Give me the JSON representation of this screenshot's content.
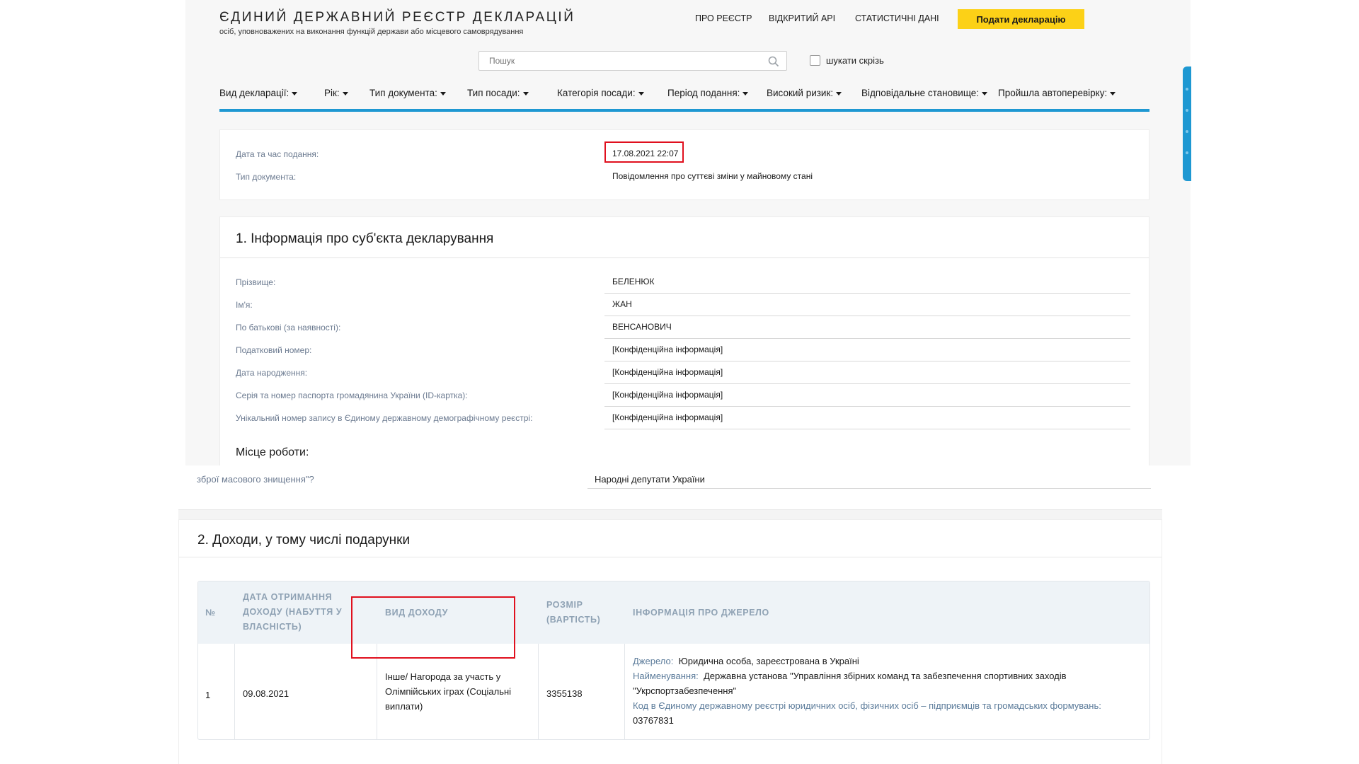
{
  "header": {
    "logo_title": "ЄДИНИЙ ДЕРЖАВНИЙ РЕЄСТР ДЕКЛАРАЦІЙ",
    "logo_subtitle": "осіб, уповноважених на виконання функцій держави або місцевого самоврядування",
    "nav": {
      "about": "ПРО РЕЄСТР",
      "api": "ВІДКРИТИЙ API",
      "stats": "СТАТИСТИЧНІ ДАНІ"
    },
    "submit_button": "Подати декларацію"
  },
  "search": {
    "placeholder": "Пошук",
    "search_everywhere_label": "шукати скрізь"
  },
  "filters": [
    "Вид декларації:",
    "Рік:",
    "Тип документа:",
    "Тип посади:",
    "Категорія посади:",
    "Період подання:",
    "Високий ризик:",
    "Відповідальне становище:",
    "Пройшла автоперевірку:"
  ],
  "meta": {
    "submitted_label": "Дата та час подання:",
    "submitted_value": "17.08.2021 22:07",
    "doc_type_label": "Тип документа:",
    "doc_type_value": "Повідомлення про суттєві зміни у майновому стані"
  },
  "subject": {
    "title": "1. Інформація про суб'єкта декларування",
    "rows": [
      {
        "label": "Прізвище:",
        "value": "БЕЛЕНЮК"
      },
      {
        "label": "Ім'я:",
        "value": "ЖАН"
      },
      {
        "label": "По батькові (за наявності):",
        "value": "ВЕНСАНОВИЧ"
      },
      {
        "label": "Податковий номер:",
        "value": "[Конфіденційна інформація]"
      },
      {
        "label": "Дата народження:",
        "value": "[Конфіденційна інформація]"
      },
      {
        "label": "Серія та номер паспорта громадянина України (ID-картка):",
        "value": "[Конфіденційна інформація]"
      },
      {
        "label": "Унікальний номер запису в Єдиному державному демографічному реєстрі:",
        "value": "[Конфіденційна інформація]"
      }
    ],
    "workplace_title": "Місце роботи:"
  },
  "fragment": {
    "left_text": "зброї масового знищення\"?",
    "right_text": "Народні депутати України"
  },
  "income": {
    "title": "2. Доходи, у тому числі подарунки",
    "headers": {
      "num": "№",
      "date": "ДАТА ОТРИМАННЯ ДОХОДУ (НАБУТТЯ У ВЛАСНІСТЬ)",
      "type": "ВИД ДОХОДУ",
      "amount": "РОЗМІР (ВАРТІСТЬ)",
      "source": "ІНФОРМАЦІЯ ПРО ДЖЕРЕЛО"
    },
    "row": {
      "num": "1",
      "date": "09.08.2021",
      "type": "Інше/ Нагорода за участь у Олімпійських іграх (Соціальні виплати)",
      "amount": "3355138",
      "source_label": "Джерело:",
      "source_value": "Юридична особа, зареєстрована в Україні",
      "name_label": "Найменування:",
      "name_value": "Державна установа \"Управління збірних команд та забезпечення спортивних заходів \"Укрспортзабезпечення\"",
      "code_label": "Код в Єдиному державному реєстрі юридичних осіб, фізичних осіб – підприємців та громадських формувань:",
      "code_value": "03767831"
    }
  }
}
